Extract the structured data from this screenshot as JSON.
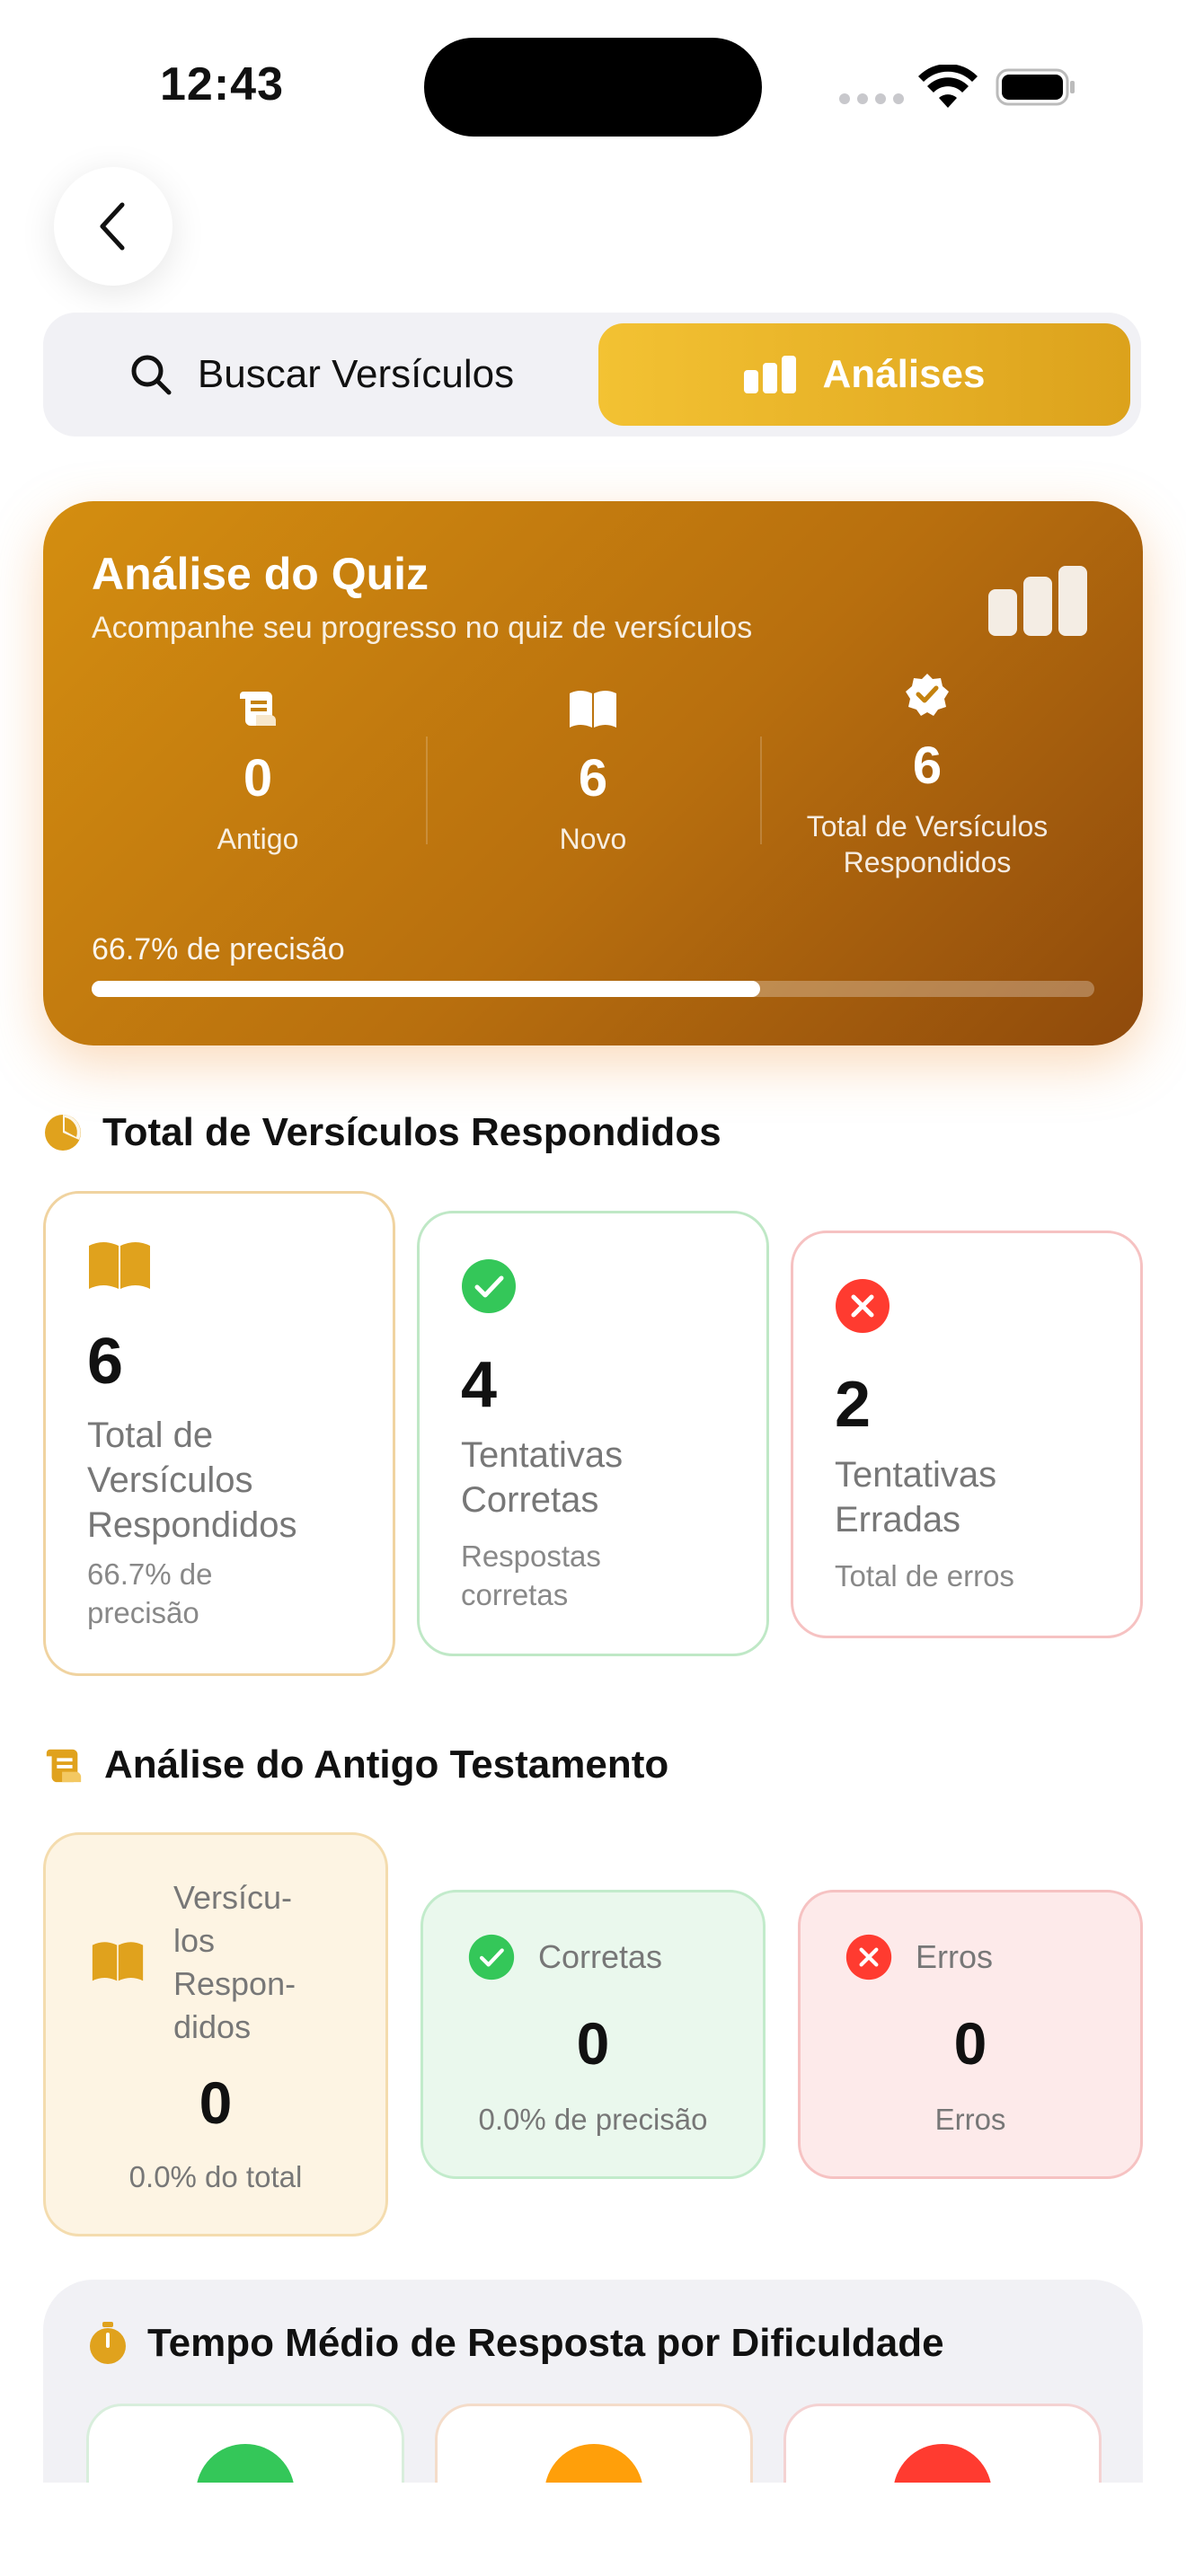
{
  "status": {
    "time": "12:43"
  },
  "tabs": {
    "search": "Buscar Versículos",
    "analysis": "Análises"
  },
  "hero": {
    "title": "Análise do Quiz",
    "subtitle": "Acompanhe seu progresso no quiz de versículos",
    "stats": [
      {
        "value": "0",
        "label": "Antigo",
        "icon": "scroll-icon"
      },
      {
        "value": "6",
        "label": "Novo",
        "icon": "book-icon"
      },
      {
        "value": "6",
        "label": "Total de Versículos Respondidos",
        "icon": "verified-badge-icon"
      }
    ],
    "precision_text": "66.7% de precisão",
    "precision_fraction": 0.667
  },
  "total_section": {
    "title": "Total de Versículos Respondidos",
    "cards": [
      {
        "value": "6",
        "name": "Total de Versículos Respondidos",
        "desc": "66.7% de precisão",
        "icon": "book-icon",
        "color": "#f0d3a0"
      },
      {
        "value": "4",
        "name": "Tentativas Corretas",
        "desc": "Respostas corretas",
        "icon": "check-circle-icon",
        "color": "#bfe8c6"
      },
      {
        "value": "2",
        "name": "Tentativas Erradas",
        "desc": "Total de erros",
        "icon": "x-circle-icon",
        "color": "#f6c2c2"
      }
    ]
  },
  "ot_section": {
    "title": "Análise do Antigo Testamento",
    "cards": [
      {
        "label": "Versícu-los Respon-didos",
        "label_lines": [
          "Versícu-",
          "los",
          "Respon-",
          "didos"
        ],
        "value": "0",
        "sub": "0.0% do total",
        "icon": "book-icon"
      },
      {
        "label": "Corretas",
        "value": "0",
        "sub": "0.0% de precisão",
        "icon": "check-circle-icon"
      },
      {
        "label": "Erros",
        "value": "0",
        "sub": "Erros",
        "icon": "x-circle-icon"
      }
    ]
  },
  "time_section": {
    "title": "Tempo Médio de Resposta por Dificuldade"
  },
  "colors": {
    "gold": "#e0a21d",
    "green": "#34c759",
    "red": "#ff3b30",
    "orange": "#ff9f0a"
  }
}
